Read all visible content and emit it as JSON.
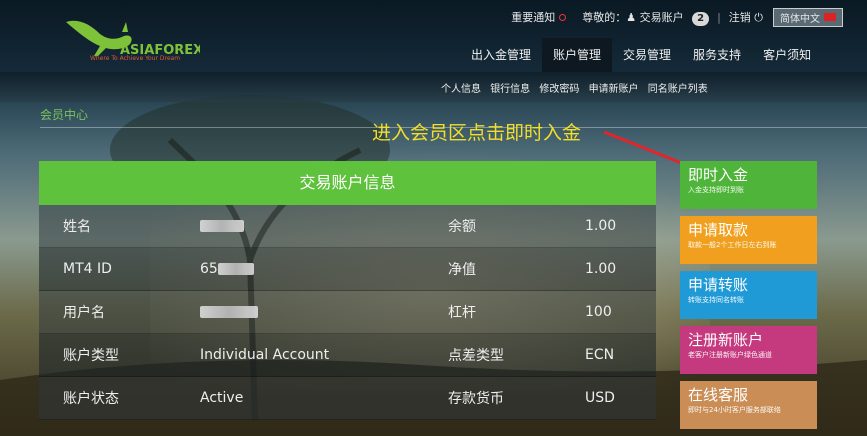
{
  "brand": {
    "tagline": "Where To Achieve Your Dream",
    "logo_text": "ASIAFOREX"
  },
  "top": {
    "notice": "重要通知",
    "greeting": "尊敬的：",
    "account": "交易账户",
    "account_count": "2",
    "logout": "注销",
    "language": "简体中文"
  },
  "nav": [
    "出入金管理",
    "账户管理",
    "交易管理",
    "服务支持",
    "客户须知"
  ],
  "subnav": [
    "个人信息",
    "银行信息",
    "修改密码",
    "申请新账户",
    "同名账户列表"
  ],
  "breadcrumb": "会员中心",
  "annotation": "进入会员区点击即时入金",
  "card": {
    "title": "交易账户信息",
    "rows": [
      {
        "l1": "姓名",
        "v1": "",
        "l2": "余额",
        "v2": "1.00"
      },
      {
        "l1": "MT4 ID",
        "v1": "65",
        "l2": "净值",
        "v2": "1.00"
      },
      {
        "l1": "用户名",
        "v1": "",
        "l2": "杠杆",
        "v2": "100"
      },
      {
        "l1": "账户类型",
        "v1": "Individual Account",
        "l2": "点差类型",
        "v2": "ECN"
      },
      {
        "l1": "账户状态",
        "v1": "Active",
        "l2": "存款货币",
        "v2": "USD"
      }
    ]
  },
  "actions": [
    {
      "title": "即时入金",
      "sub": "入金支持即时到账",
      "color": "#4fb43a"
    },
    {
      "title": "申请取款",
      "sub": "取款一般2个工作日左右到账",
      "color": "#f0a01e"
    },
    {
      "title": "申请转账",
      "sub": "转账支持同名转账",
      "color": "#1f9ad6"
    },
    {
      "title": "注册新账户",
      "sub": "老客户注册新账户绿色通道",
      "color": "#c5397f"
    },
    {
      "title": "在线客服",
      "sub": "即时与24小时客户服务部联络",
      "color": "#c98d55"
    }
  ]
}
